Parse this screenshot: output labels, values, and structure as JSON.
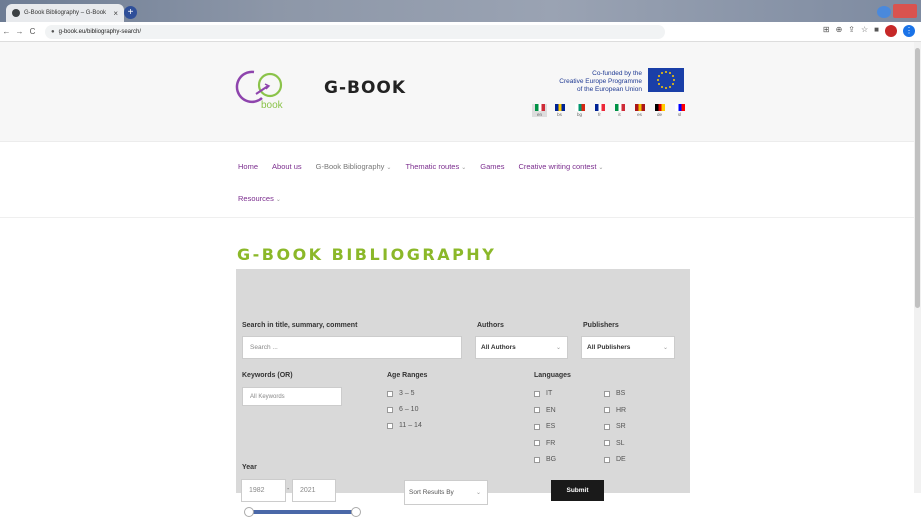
{
  "browser": {
    "tab_title": "G-Book Bibliography – G-Book",
    "tab_close": "×",
    "new_tab": "+",
    "back": "←",
    "forward": "→",
    "reload": "C",
    "url": "g-book.eu/bibliography-search/"
  },
  "header": {
    "logo_text": "book",
    "site_title": "G-BOOK",
    "eu_line1": "Co-funded by the",
    "eu_line2": "Creative Europe Programme",
    "eu_line3": "of the European Union",
    "languages": [
      {
        "code": "en",
        "colors": [
          "#009246",
          "#ffffff",
          "#ce2b37"
        ]
      },
      {
        "code": "bs",
        "colors": [
          "#002395",
          "#fecb00",
          "#002395"
        ]
      },
      {
        "code": "bg",
        "colors": [
          "#ffffff",
          "#00966e",
          "#d62612"
        ]
      },
      {
        "code": "fr",
        "colors": [
          "#002395",
          "#ffffff",
          "#ed2939"
        ]
      },
      {
        "code": "it",
        "colors": [
          "#009246",
          "#ffffff",
          "#ce2b37"
        ]
      },
      {
        "code": "es",
        "colors": [
          "#aa151b",
          "#f1bf00",
          "#aa151b"
        ]
      },
      {
        "code": "de",
        "colors": [
          "#000000",
          "#dd0000",
          "#ffce00"
        ]
      },
      {
        "code": "sl",
        "colors": [
          "#ffffff",
          "#0000ff",
          "#ff0000"
        ]
      }
    ]
  },
  "nav": {
    "home": "Home",
    "about": "About us",
    "bibliography": "G-Book Bibliography",
    "thematic": "Thematic routes",
    "games": "Games",
    "contest": "Creative writing contest",
    "resources": "Resources",
    "chevron": "⌄"
  },
  "main": {
    "title": "G-BOOK BIBLIOGRAPHY",
    "search_label": "Search in title, summary, comment",
    "search_placeholder": "Search ...",
    "authors_label": "Authors",
    "authors_value": "All Authors",
    "publishers_label": "Publishers",
    "publishers_value": "All Publishers",
    "keywords_label": "Keywords (OR)",
    "keywords_placeholder": "All Keywords",
    "age_label": "Age Ranges",
    "ages": [
      "3 – 5",
      "6 – 10",
      "11 – 14"
    ],
    "languages_label": "Languages",
    "lang_col1": [
      "IT",
      "EN",
      "ES",
      "FR",
      "BG"
    ],
    "lang_col2": [
      "BS",
      "HR",
      "SR",
      "SL",
      "DE"
    ],
    "year_label": "Year",
    "year_from": "1982",
    "year_to": "2021",
    "year_sep": "-",
    "sort_value": "Sort Results By",
    "submit_label": "Submit",
    "caret": "⌄"
  }
}
